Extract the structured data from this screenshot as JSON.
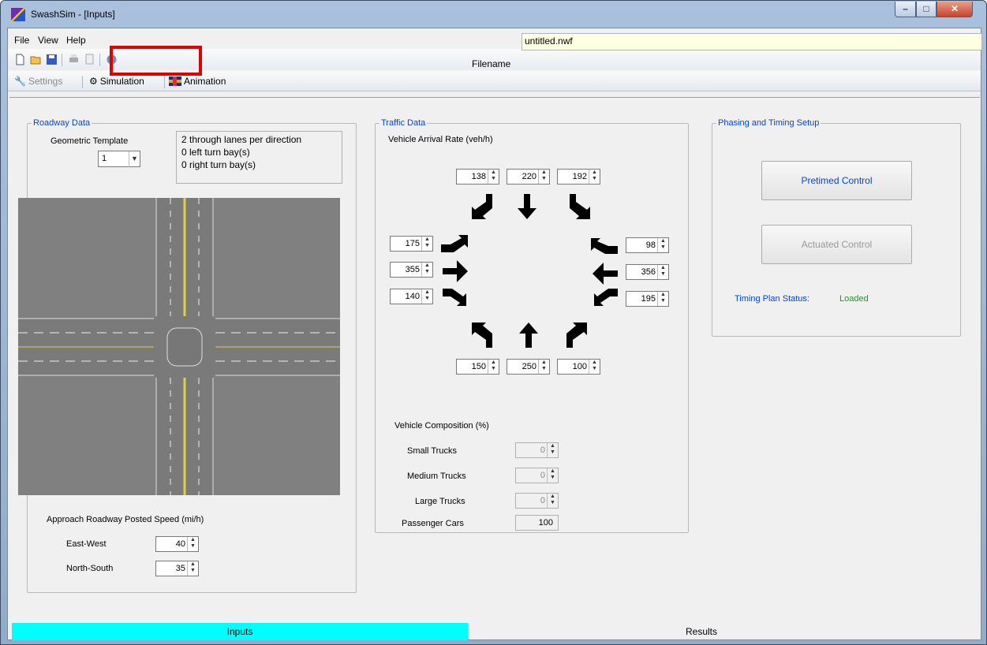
{
  "window": {
    "title": "SwashSim - [Inputs]"
  },
  "menu": {
    "file": "File",
    "view": "View",
    "help": "Help"
  },
  "toolbar": {
    "filename_label": "Filename",
    "filename_value": "untitled.nwf"
  },
  "toolbar2": {
    "settings": "Settings",
    "simulation": "Simulation",
    "animation": "Animation"
  },
  "roadway": {
    "legend": "Roadway Data",
    "template_label": "Geometric Template",
    "template_value": "1",
    "info": [
      "2 through lanes per direction",
      "0 left turn bay(s)",
      "0 right turn bay(s)"
    ],
    "speed_title": "Approach Roadway Posted Speed (mi/h)",
    "ew_label": "East-West",
    "ew_value": "40",
    "ns_label": "North-South",
    "ns_value": "35"
  },
  "traffic": {
    "legend": "Traffic Data",
    "arrival_title": "Vehicle Arrival Rate (veh/h)",
    "north_top": [
      "138",
      "220",
      "192"
    ],
    "west": [
      "175",
      "355",
      "140"
    ],
    "east": [
      "98",
      "356",
      "195"
    ],
    "south_bottom": [
      "150",
      "250",
      "100"
    ],
    "composition_title": "Vehicle Composition (%)",
    "small_trucks_label": "Small Trucks",
    "small_trucks": "0",
    "medium_trucks_label": "Medium Trucks",
    "medium_trucks": "0",
    "large_trucks_label": "Large Trucks",
    "large_trucks": "0",
    "passenger_cars_label": "Passenger Cars",
    "passenger_cars": "100"
  },
  "phasing": {
    "legend": "Phasing and Timing Setup",
    "pretimed": "Pretimed Control",
    "actuated": "Actuated Control",
    "status_label": "Timing Plan Status:",
    "status_value": "Loaded",
    "status_color": "#1a9a1a"
  },
  "tabs": {
    "inputs": "Inputs",
    "results": "Results",
    "active_color": "#00ffff"
  }
}
